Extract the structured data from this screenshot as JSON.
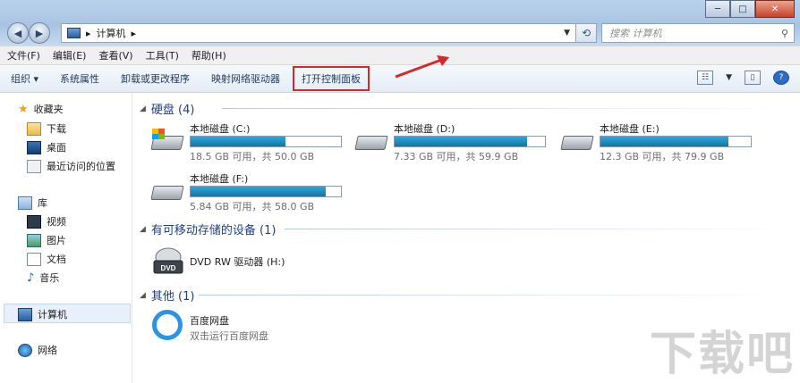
{
  "window": {
    "buttons": {
      "minimize": "─",
      "maximize": "□",
      "close": "✕"
    }
  },
  "address": {
    "path": "计算机",
    "sep": "▸"
  },
  "search": {
    "placeholder": "搜索 计算机"
  },
  "menu": [
    "文件(F)",
    "编辑(E)",
    "查看(V)",
    "工具(T)",
    "帮助(H)"
  ],
  "toolbar": {
    "items": [
      "组织 ▾",
      "系统属性",
      "卸载或更改程序",
      "映射网络驱动器"
    ],
    "highlighted": "打开控制面板"
  },
  "sidebar": {
    "favorites": "收藏夹",
    "favorites_items": [
      "下载",
      "桌面",
      "最近访问的位置"
    ],
    "library": "库",
    "library_items": [
      "视频",
      "图片",
      "文档",
      "音乐"
    ],
    "computer": "计算机",
    "network": "网络"
  },
  "groups": {
    "hdd": "硬盘 (4)",
    "removable": "有可移动存储的设备 (1)",
    "other": "其他 (1)"
  },
  "drives": [
    {
      "name": "本地磁盘 (C:)",
      "info": "18.5 GB 可用，共 50.0 GB",
      "used_pct": 63
    },
    {
      "name": "本地磁盘 (D:)",
      "info": "7.33 GB 可用，共 59.9 GB",
      "used_pct": 88
    },
    {
      "name": "本地磁盘 (E:)",
      "info": "12.3 GB 可用，共 79.9 GB",
      "used_pct": 85
    },
    {
      "name": "本地磁盘 (F:)",
      "info": "5.84 GB 可用，共 58.0 GB",
      "used_pct": 90
    }
  ],
  "dvd": {
    "name": "DVD RW 驱动器 (H:)",
    "badge": "DVD"
  },
  "other_item": {
    "name": "百度网盘",
    "desc": "双击运行百度网盘"
  },
  "watermark": "下载吧",
  "colors": {
    "highlight_box": "#d32a2a",
    "bar_fill": "#1f8fc2"
  }
}
